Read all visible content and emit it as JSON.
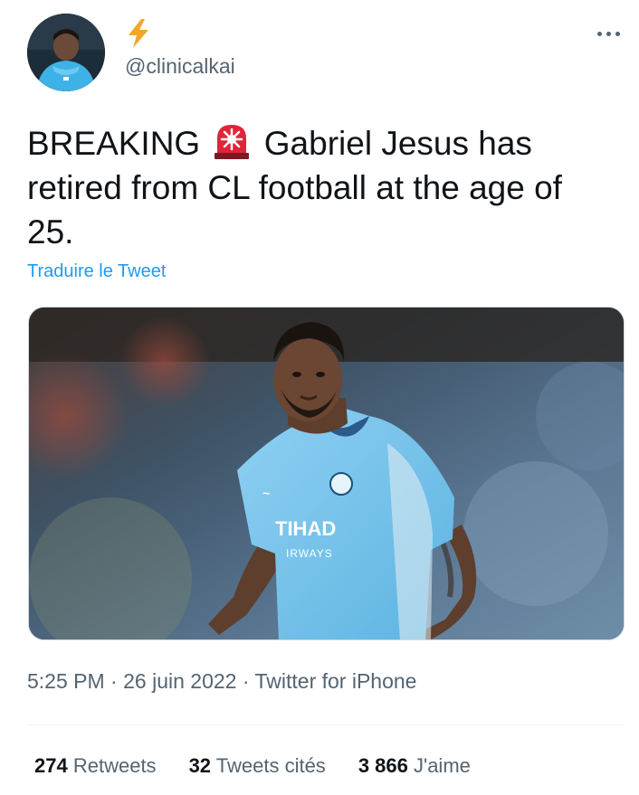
{
  "author": {
    "display_name_icon": "lightning-bolt-icon",
    "handle": "@clinicalkai"
  },
  "tweet": {
    "text_before_emoji": "BREAKING",
    "emoji": "police-car-light-icon",
    "text_after_emoji": " Gabriel Jesus has retired from CL football at the age of 25.",
    "translate_label": "Traduire le Tweet"
  },
  "media": {
    "description_icon": "photo-football-player-icon"
  },
  "meta": {
    "time": "5:25 PM",
    "separator1": "·",
    "date": "26 juin 2022",
    "separator2": "·",
    "source": "Twitter for iPhone"
  },
  "stats": {
    "retweets_count": "274",
    "retweets_label": "Retweets",
    "quotes_count": "32",
    "quotes_label": "Tweets cités",
    "likes_count": "3 866",
    "likes_label": "J'aime"
  },
  "colors": {
    "link": "#1d9bf0",
    "secondary_text": "#536471",
    "primary_text": "#0f1419",
    "bolt": "#f4a52a",
    "siren": "#e0243a"
  }
}
